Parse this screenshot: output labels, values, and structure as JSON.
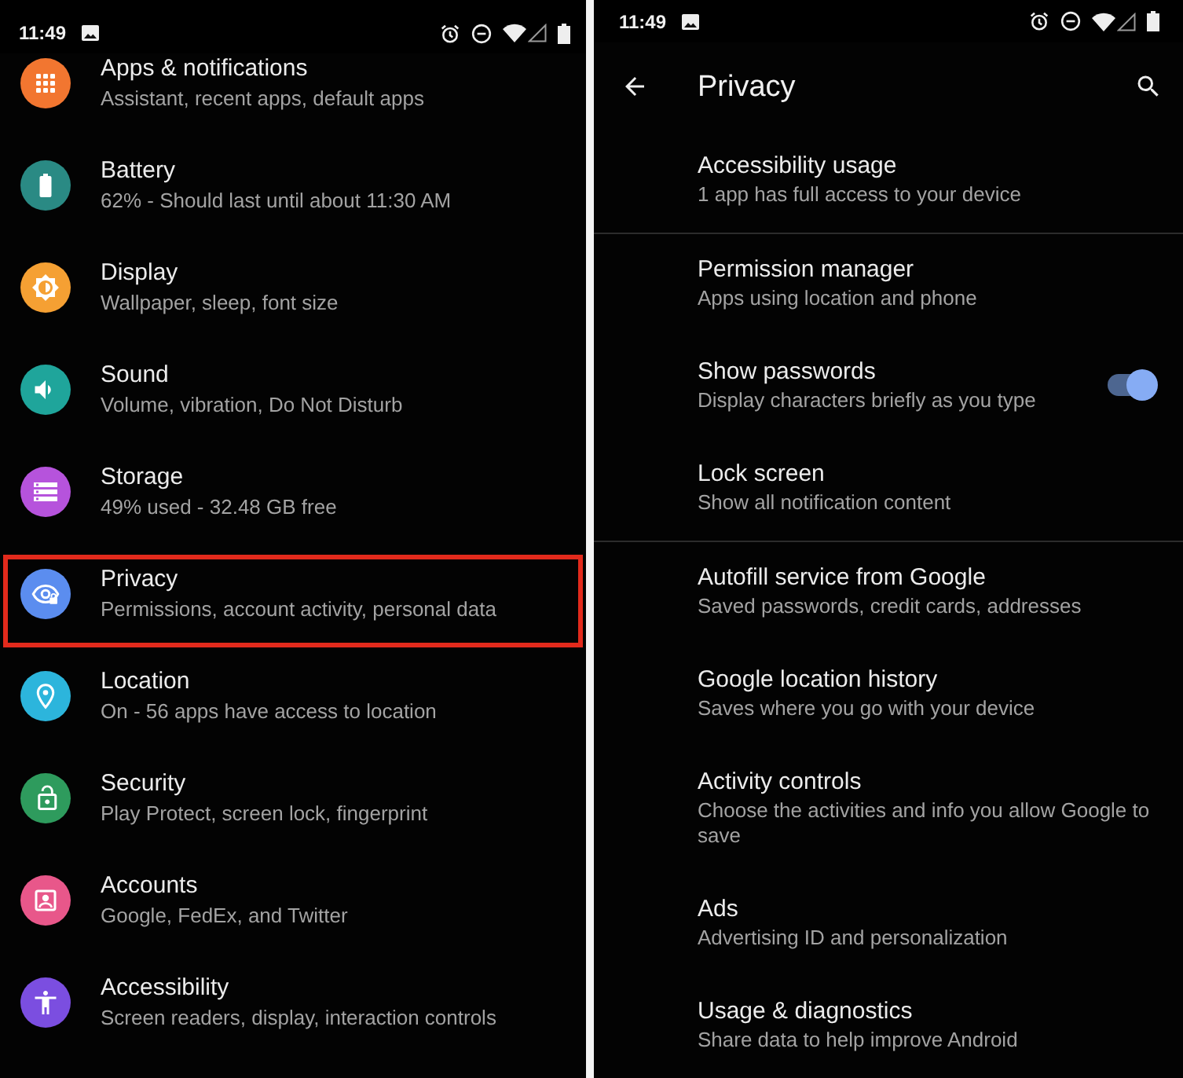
{
  "left_screen": {
    "status_bar": {
      "time": "11:49"
    },
    "settings": [
      {
        "title": "Apps & notifications",
        "subtitle": "Assistant, recent apps, default apps",
        "color": "#f27630",
        "highlighted": false
      },
      {
        "title": "Battery",
        "subtitle": "62% - Should last until about 11:30 AM",
        "color": "#2a8a84",
        "highlighted": false
      },
      {
        "title": "Display",
        "subtitle": "Wallpaper, sleep, font size",
        "color": "#f5a033",
        "highlighted": false
      },
      {
        "title": "Sound",
        "subtitle": "Volume, vibration, Do Not Disturb",
        "color": "#1fa59b",
        "highlighted": false
      },
      {
        "title": "Storage",
        "subtitle": "49% used - 32.48 GB free",
        "color": "#b653dc",
        "highlighted": false
      },
      {
        "title": "Privacy",
        "subtitle": "Permissions, account activity, personal data",
        "color": "#5b8def",
        "highlighted": true
      },
      {
        "title": "Location",
        "subtitle": "On - 56 apps have access to location",
        "color": "#2cb5dc",
        "highlighted": false
      },
      {
        "title": "Security",
        "subtitle": "Play Protect, screen lock, fingerprint",
        "color": "#2e9b5d",
        "highlighted": false
      },
      {
        "title": "Accounts",
        "subtitle": "Google, FedEx, and Twitter",
        "color": "#e8578a",
        "highlighted": false
      },
      {
        "title": "Accessibility",
        "subtitle": "Screen readers, display, interaction controls",
        "color": "#7b4ee0",
        "highlighted": false
      }
    ]
  },
  "right_screen": {
    "status_bar": {
      "time": "11:49"
    },
    "toolbar": {
      "title": "Privacy"
    },
    "sections": [
      {
        "items": [
          {
            "kind": "link",
            "title": "Accessibility usage",
            "subtitle": "1 app has full access to your device"
          }
        ]
      },
      {
        "items": [
          {
            "kind": "link",
            "title": "Permission manager",
            "subtitle": "Apps using location and phone"
          },
          {
            "kind": "toggle",
            "title": "Show passwords",
            "subtitle": "Display characters briefly as you type",
            "on": true
          },
          {
            "kind": "link",
            "title": "Lock screen",
            "subtitle": "Show all notification content"
          }
        ]
      },
      {
        "items": [
          {
            "kind": "link",
            "title": "Autofill service from Google",
            "subtitle": "Saved passwords, credit cards, addresses"
          },
          {
            "kind": "link",
            "title": "Google location history",
            "subtitle": "Saves where you go with your device"
          },
          {
            "kind": "link",
            "title": "Activity controls",
            "subtitle": "Choose the activities and info you allow Google to save"
          },
          {
            "kind": "link",
            "title": "Ads",
            "subtitle": "Advertising ID and personalization"
          },
          {
            "kind": "link",
            "title": "Usage & diagnostics",
            "subtitle": "Share data to help improve Android"
          }
        ]
      }
    ]
  }
}
